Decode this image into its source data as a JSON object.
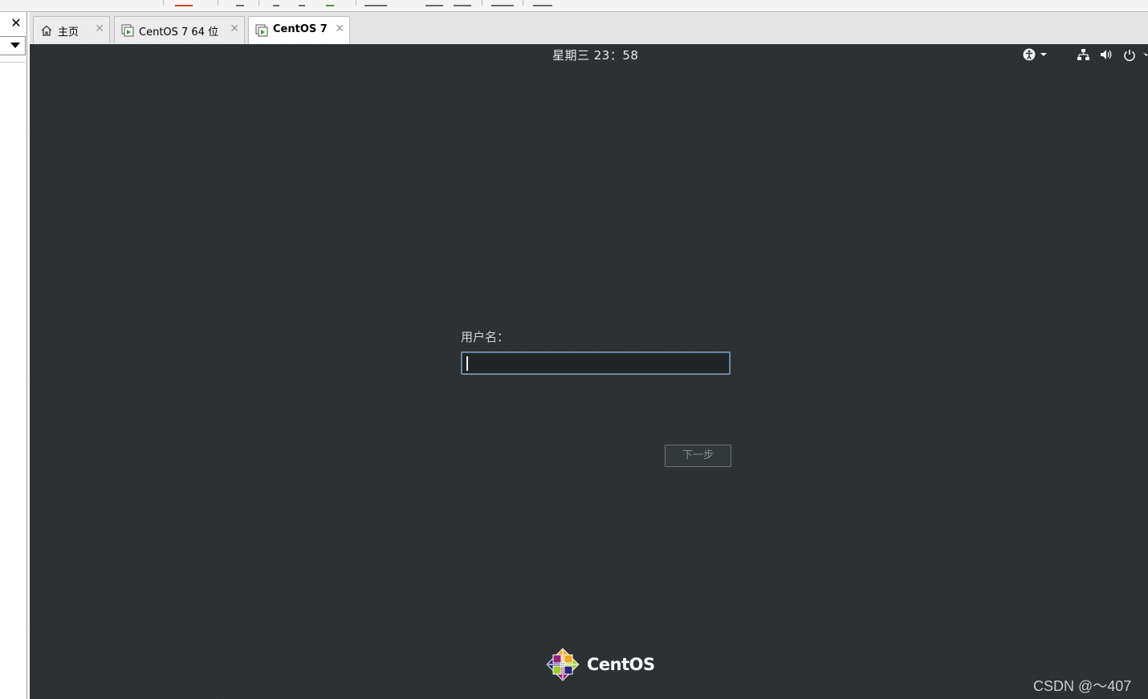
{
  "left_panel": {
    "close_glyph": "✕"
  },
  "tabs": [
    {
      "label": "主页",
      "icon": "home-icon",
      "active": false
    },
    {
      "label": "CentOS 7 64 位",
      "icon": "vm-icon",
      "active": false
    },
    {
      "label": "CentOS 7",
      "icon": "vm-icon",
      "active": true
    }
  ],
  "tab_close_glyph": "✕",
  "vm": {
    "clock": "星期三 23：58",
    "tray_icons": [
      "accessibility-icon",
      "network-icon",
      "volume-icon",
      "power-icon"
    ],
    "login": {
      "username_label": "用户名：",
      "username_value": "",
      "next_button": "下一步"
    },
    "logo_text": "CentOS",
    "watermark": "CSDN @～407"
  },
  "colors": {
    "vm_background": "#2b2f31",
    "input_background": "#212425",
    "focus_ring": "#4f7ba8"
  }
}
